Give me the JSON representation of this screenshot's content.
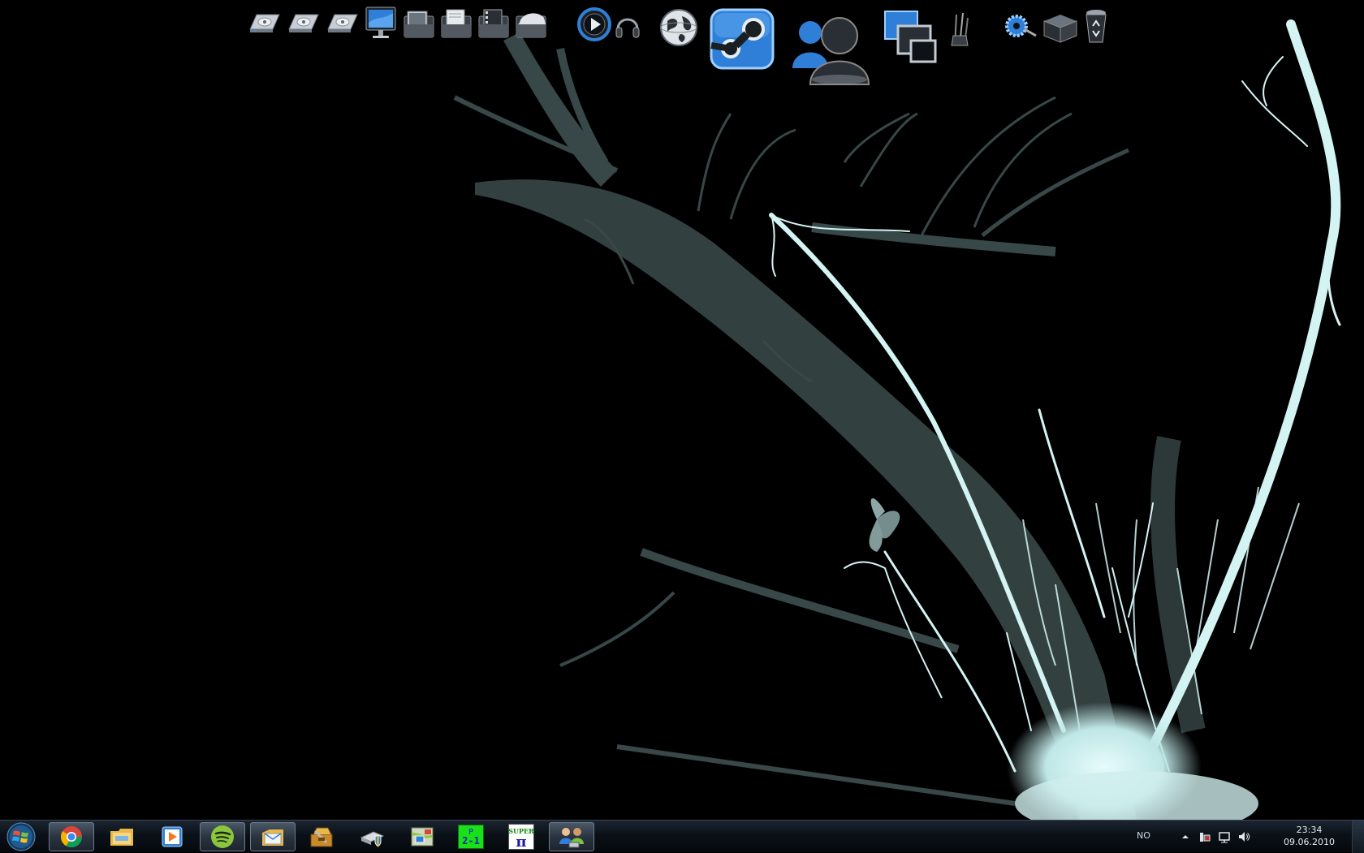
{
  "desktop": {
    "dock_icons": [
      {
        "name": "hard-drive-1-icon"
      },
      {
        "name": "hard-drive-2-icon"
      },
      {
        "name": "hard-drive-3-icon"
      },
      {
        "name": "computer-monitor-icon"
      },
      {
        "name": "pictures-folder-icon"
      },
      {
        "name": "documents-folder-icon"
      },
      {
        "name": "videos-folder-icon"
      },
      {
        "name": "downloads-folder-icon"
      },
      {
        "name": "media-player-icon"
      },
      {
        "name": "headphones-icon"
      },
      {
        "name": "globe-icon"
      },
      {
        "name": "steam-icon"
      },
      {
        "name": "messenger-icon"
      },
      {
        "name": "windows-monitor-icon"
      },
      {
        "name": "paint-brushes-icon"
      },
      {
        "name": "settings-gear-icon"
      },
      {
        "name": "box-icon"
      },
      {
        "name": "recycle-bin-icon"
      }
    ]
  },
  "taskbar": {
    "buttons": [
      {
        "name": "chrome-icon",
        "active": true
      },
      {
        "name": "explorer-folder-icon",
        "active": false
      },
      {
        "name": "media-play-icon",
        "active": false
      },
      {
        "name": "spotify-icon",
        "active": true
      },
      {
        "name": "mail-icon",
        "active": true
      },
      {
        "name": "tool-box-icon",
        "active": false
      },
      {
        "name": "security-shield-icon",
        "active": false
      },
      {
        "name": "network-map-icon",
        "active": false
      },
      {
        "name": "p21-app-icon",
        "active": false,
        "label_top": "P",
        "label_bottom": "2-1"
      },
      {
        "name": "superpi-app-icon",
        "active": false,
        "label_top": "SUPER",
        "label_bottom": "π"
      },
      {
        "name": "users-network-icon",
        "active": true
      }
    ],
    "tray": {
      "language": "NO",
      "time": "23:34",
      "date": "09.06.2010"
    }
  },
  "colors": {
    "splash_light": "#d4f4f4",
    "splash_dark": "#384747",
    "taskbar_bg": "#0b1118",
    "accent_blue": "#2f7fd8"
  }
}
